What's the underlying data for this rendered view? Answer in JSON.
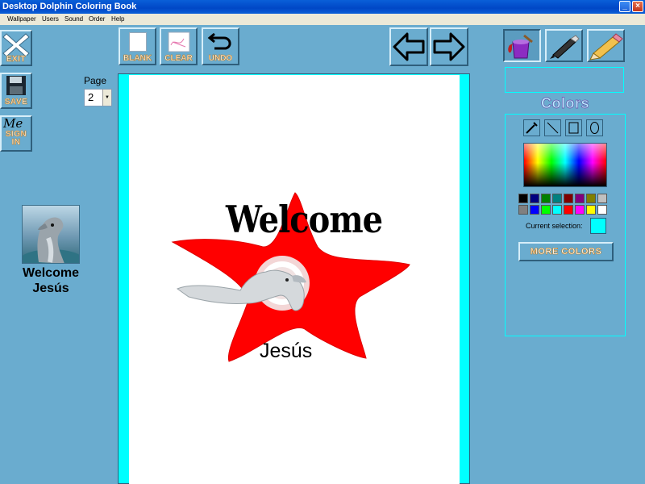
{
  "window": {
    "title": "Desktop Dolphin Coloring Book"
  },
  "menu": [
    "Wallpaper",
    "Users",
    "Sound",
    "Order",
    "Help"
  ],
  "left_tools": {
    "exit_label": "EXIT",
    "save_label": "SAVE",
    "signin_label_top": "SIGN",
    "signin_label_bottom": "IN",
    "signin_icon_text": "Me"
  },
  "page": {
    "label": "Page",
    "value": "2"
  },
  "user": {
    "welcome_line": "Welcome",
    "name": "Jesús"
  },
  "toolbar": {
    "blank_label": "BLANK",
    "clear_label": "CLEAR",
    "undo_label": "UNDO"
  },
  "canvas": {
    "welcome_text": "Welcome",
    "name_text": "Jesús"
  },
  "colors": {
    "title": "Colors",
    "palette_row1": [
      "#000000",
      "#000080",
      "#008000",
      "#008080",
      "#800000",
      "#800080",
      "#808000",
      "#c0c0c0"
    ],
    "palette_row2": [
      "#808080",
      "#0000ff",
      "#00ff00",
      "#00ffff",
      "#ff0000",
      "#ff00ff",
      "#ffff00",
      "#ffffff"
    ],
    "current_label": "Current selection:",
    "current_color": "#00ffff",
    "more_colors_label": "MORE COLORS"
  },
  "theme": {
    "background": "#6aaccf",
    "canvas_border": "#00ffff",
    "starfish": "#ff0000"
  }
}
